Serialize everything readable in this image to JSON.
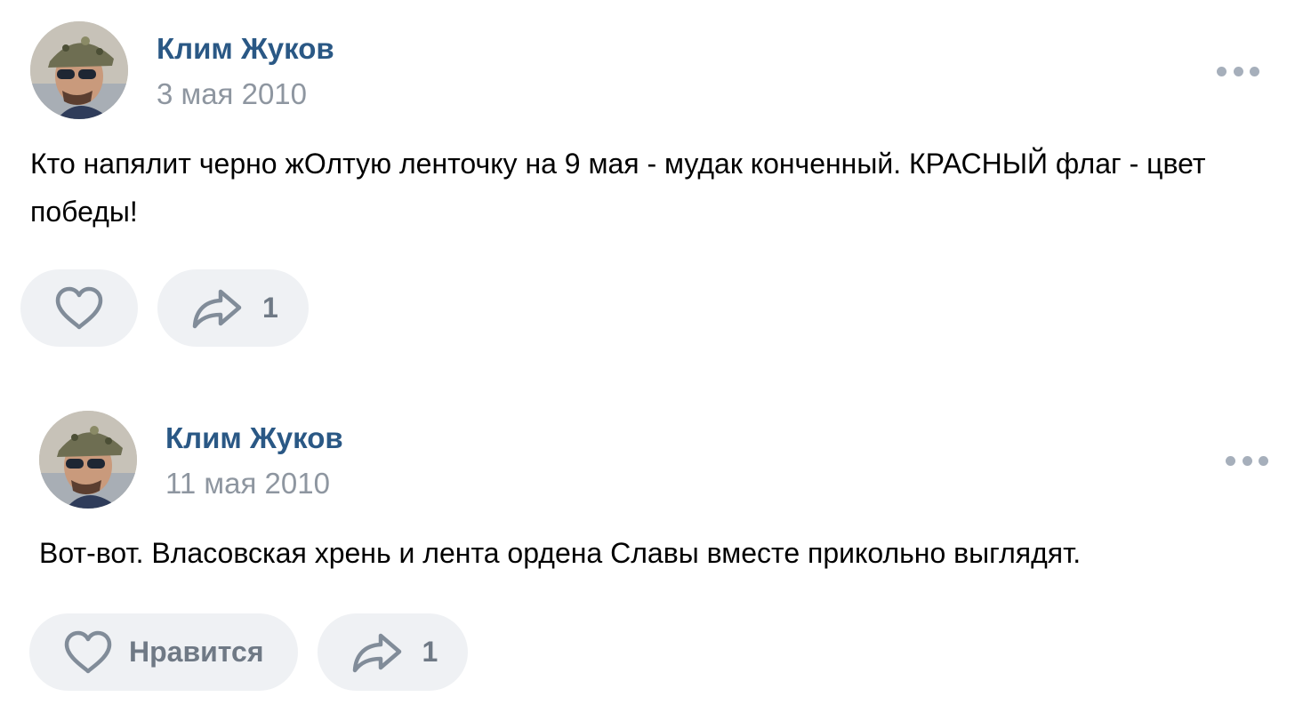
{
  "posts": [
    {
      "author": "Клим Жуков",
      "date": "3 мая 2010",
      "text": "Кто напялит черно жОлтую ленточку на 9 мая - мудак конченный. КРАСНЫЙ флаг - цвет победы!",
      "like_label": "",
      "share_count": "1"
    },
    {
      "author": "Клим Жуков",
      "date": "11 мая 2010",
      "text": "Вот-вот. Власовская хрень и лента ордена Славы вместе прикольно выглядят.",
      "like_label": "Нравится",
      "share_count": "1"
    }
  ],
  "colors": {
    "author_link": "#2a5885",
    "secondary_text": "#8e96a0",
    "pill_background": "#eff1f4",
    "icon": "#818c99"
  },
  "icons": {
    "like": "heart-icon",
    "share": "share-arrow-icon",
    "more": "more-dots-icon"
  }
}
